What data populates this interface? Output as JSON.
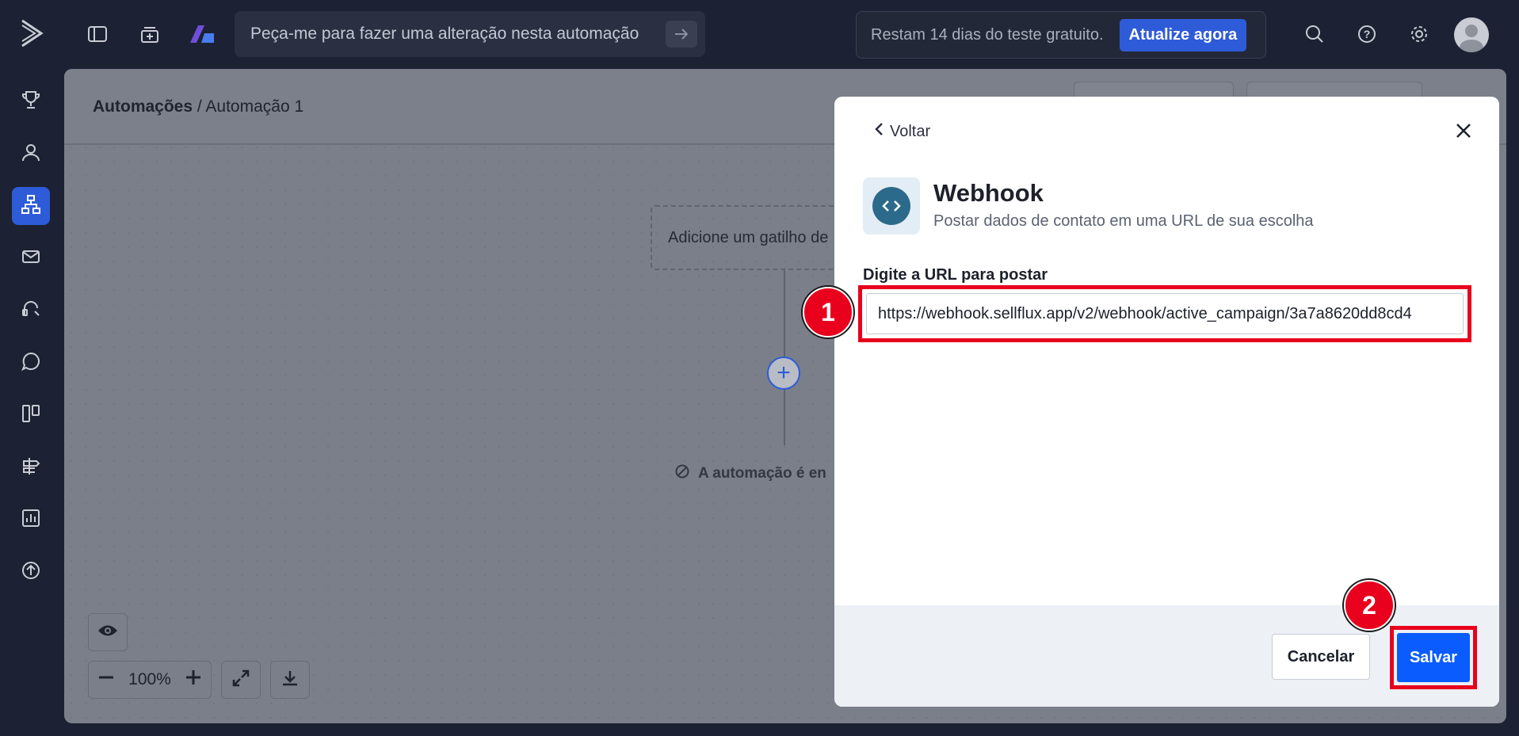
{
  "topbar": {
    "ai_placeholder": "Peça-me para fazer uma alteração nesta automação",
    "trial_text": "Restam 14 dias do teste gratuito.",
    "upgrade_label": "Atualize agora"
  },
  "sidebar": {
    "items": [
      {
        "icon": "trophy-icon"
      },
      {
        "icon": "contacts-icon"
      },
      {
        "icon": "automations-icon",
        "active": true
      },
      {
        "icon": "mail-icon"
      },
      {
        "icon": "chat-icon"
      },
      {
        "icon": "whatsapp-icon"
      },
      {
        "icon": "pipeline-icon"
      },
      {
        "icon": "signpost-icon"
      },
      {
        "icon": "reports-icon"
      },
      {
        "icon": "upgrade-icon"
      }
    ]
  },
  "canvas": {
    "breadcrumb_root": "Automações",
    "breadcrumb_sep": " / ",
    "breadcrumb_current": "Automação 1",
    "trigger_text": "Adicione um gatilho de",
    "end_text": "A automação é en",
    "zoom_level": "100%"
  },
  "modal": {
    "back_label": "Voltar",
    "title": "Webhook",
    "subtitle": "Postar dados de contato em uma URL de sua escolha",
    "url_label": "Digite a URL para postar",
    "url_value": "https://webhook.sellflux.app/v2/webhook/active_campaign/3a7a8620dd8cd4",
    "cancel_label": "Cancelar",
    "save_label": "Salvar"
  },
  "steps": {
    "step1": "1",
    "step2": "2"
  },
  "colors": {
    "accent": "#2e5bd8",
    "save": "#0a5cff",
    "highlight": "#e8001c"
  }
}
